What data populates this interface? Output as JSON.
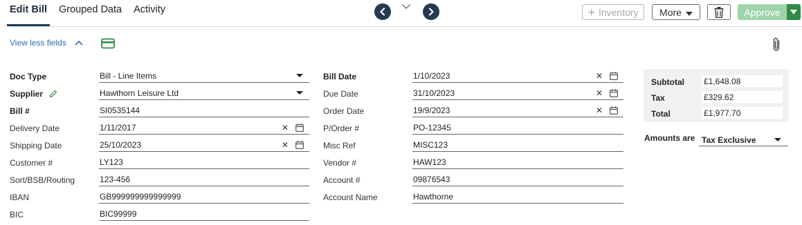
{
  "tabs": [
    "Edit Bill",
    "Grouped Data",
    "Activity"
  ],
  "toolbar": {
    "inventory_label": "Inventory",
    "more_label": "More",
    "approve_label": "Approve"
  },
  "view_less_label": "View less fields",
  "icons": {
    "prev": "chevron-left-icon",
    "next": "chevron-right-icon",
    "collapse": "chevron-down-icon",
    "card": "credit-card-icon",
    "attachment": "paperclip-icon",
    "trash": "trash-icon",
    "calendar": "calendar-icon",
    "clear": "close-icon",
    "edit": "pencil-icon"
  },
  "colors": {
    "nav": "#243a52",
    "approve": "#9fd4ab",
    "approve_dropdown": "#2e8b47",
    "link": "#2d6db5",
    "card_icon": "#2e8b47"
  },
  "left_fields": [
    {
      "label": "Doc Type",
      "value": "Bill - Line Items"
    },
    {
      "label": "Supplier",
      "value": "Hawthorn Leisure Ltd"
    },
    {
      "label": "Bill #",
      "value": "SI0535144"
    },
    {
      "label": "Delivery Date",
      "value": "1/11/2017"
    },
    {
      "label": "Shipping Date",
      "value": "25/10/2023"
    },
    {
      "label": "Customer #",
      "value": "LY123"
    },
    {
      "label": "Sort/BSB/Routing",
      "value": "123-456"
    },
    {
      "label": "IBAN",
      "value": "GB999999999999999"
    },
    {
      "label": "BIC",
      "value": "BIC99999"
    }
  ],
  "mid_fields": [
    {
      "label": "Bill Date",
      "value": "1/10/2023"
    },
    {
      "label": "Due Date",
      "value": "31/10/2023"
    },
    {
      "label": "Order Date",
      "value": "19/9/2023"
    },
    {
      "label": "P/Order #",
      "value": "PO-12345"
    },
    {
      "label": "Misc Ref",
      "value": "MISC123"
    },
    {
      "label": "Vendor #",
      "value": "HAW123"
    },
    {
      "label": "Account #",
      "value": "09876543"
    },
    {
      "label": "Account Name",
      "value": "Hawthorne"
    }
  ],
  "totals": [
    {
      "label": "Subtotal",
      "value": "£1,648.08"
    },
    {
      "label": "Tax",
      "value": "£329.62"
    },
    {
      "label": "Total",
      "value": "£1,977.70"
    }
  ],
  "amounts": {
    "label": "Amounts are",
    "value": "Tax Exclusive"
  }
}
